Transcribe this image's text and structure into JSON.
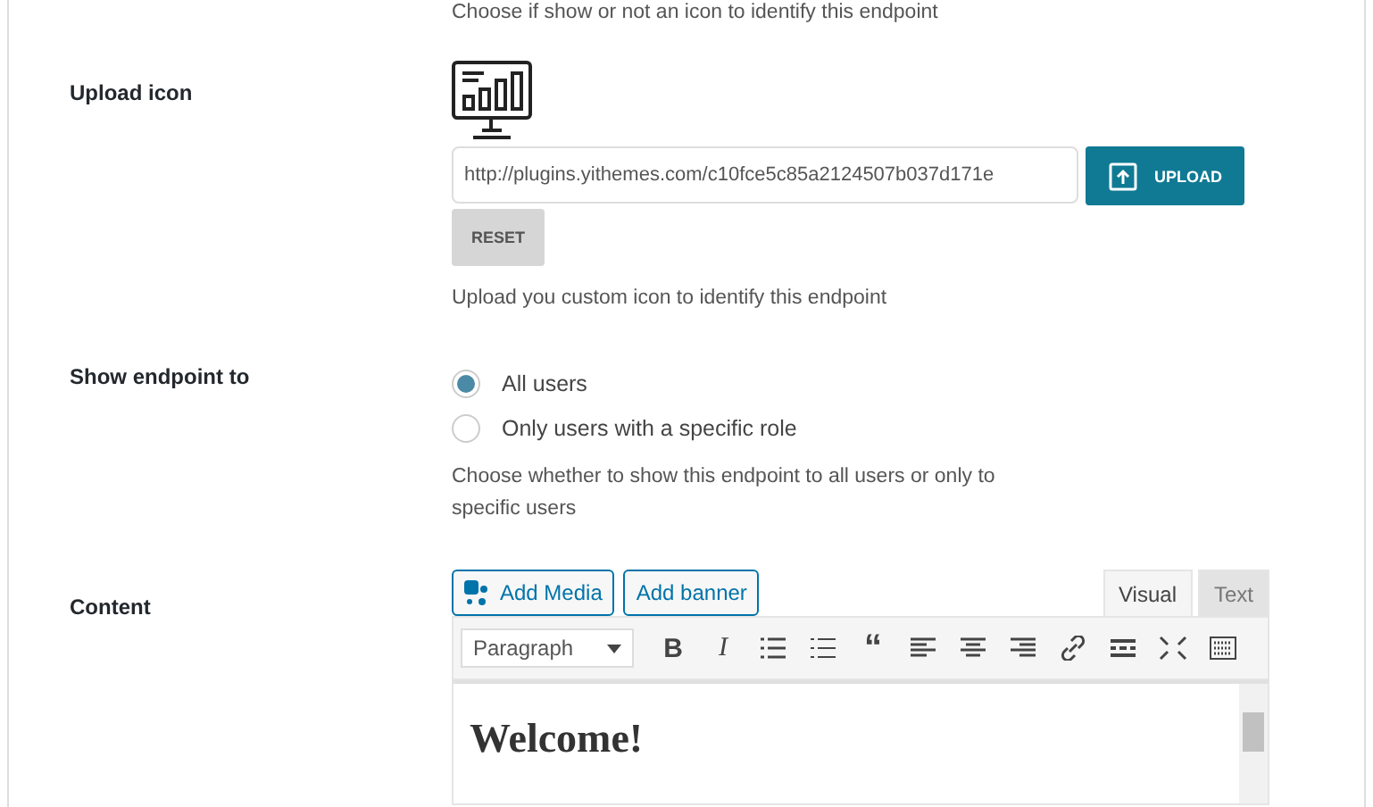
{
  "top_hint": "Choose if show or not an icon to identify this endpoint",
  "upload_icon": {
    "label": "Upload icon",
    "url_value": "http://plugins.yithemes.com/c10fce5c85a2124507b037d171e",
    "upload_button": "UPLOAD",
    "reset_button": "RESET",
    "hint": "Upload you custom icon to identify this endpoint"
  },
  "show_endpoint": {
    "label": "Show endpoint to",
    "options": [
      {
        "label": "All users",
        "selected": true
      },
      {
        "label": "Only users with a specific role",
        "selected": false
      }
    ],
    "hint": "Choose whether to show this endpoint to all users or only to specific users"
  },
  "content": {
    "label": "Content",
    "media_buttons": [
      "Add Media",
      "Add banner"
    ],
    "tabs": [
      {
        "label": "Visual",
        "selected": true
      },
      {
        "label": "Text",
        "selected": false
      }
    ],
    "format_select": "Paragraph",
    "toolbar": [
      {
        "kind": "bold",
        "label": "B"
      },
      {
        "kind": "italic",
        "label": "I"
      },
      {
        "kind": "ul"
      },
      {
        "kind": "ol"
      },
      {
        "kind": "quote",
        "label": "“"
      },
      {
        "kind": "alignleft"
      },
      {
        "kind": "aligncenter"
      },
      {
        "kind": "alignright"
      },
      {
        "kind": "link"
      },
      {
        "kind": "more"
      },
      {
        "kind": "fullscreen"
      },
      {
        "kind": "kitchen"
      }
    ],
    "editor_heading": "Welcome!"
  }
}
